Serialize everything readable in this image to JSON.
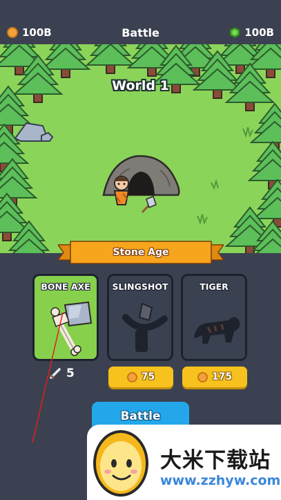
{
  "header": {
    "coins": "100B",
    "title": "Battle",
    "gems": "100B"
  },
  "world": {
    "label": "World 1"
  },
  "era": {
    "label": "Stone Age"
  },
  "cards": [
    {
      "title": "BONE AXE",
      "state": "owned",
      "stat": "5"
    },
    {
      "title": "SLINGSHOT",
      "state": "locked",
      "price": "75"
    },
    {
      "title": "TIGER",
      "state": "locked",
      "price": "175"
    }
  ],
  "battle_button": {
    "label": "Battle"
  },
  "watermark": {
    "title": "大米下载站",
    "url": "www.zzhyw.com"
  },
  "colors": {
    "background": "#3b4150",
    "grass": "#8bd45a",
    "selected_card": "#86d04c",
    "price_button": "#f7c21d",
    "battle_button": "#24a7ea",
    "era_banner": "#f7a51c"
  }
}
